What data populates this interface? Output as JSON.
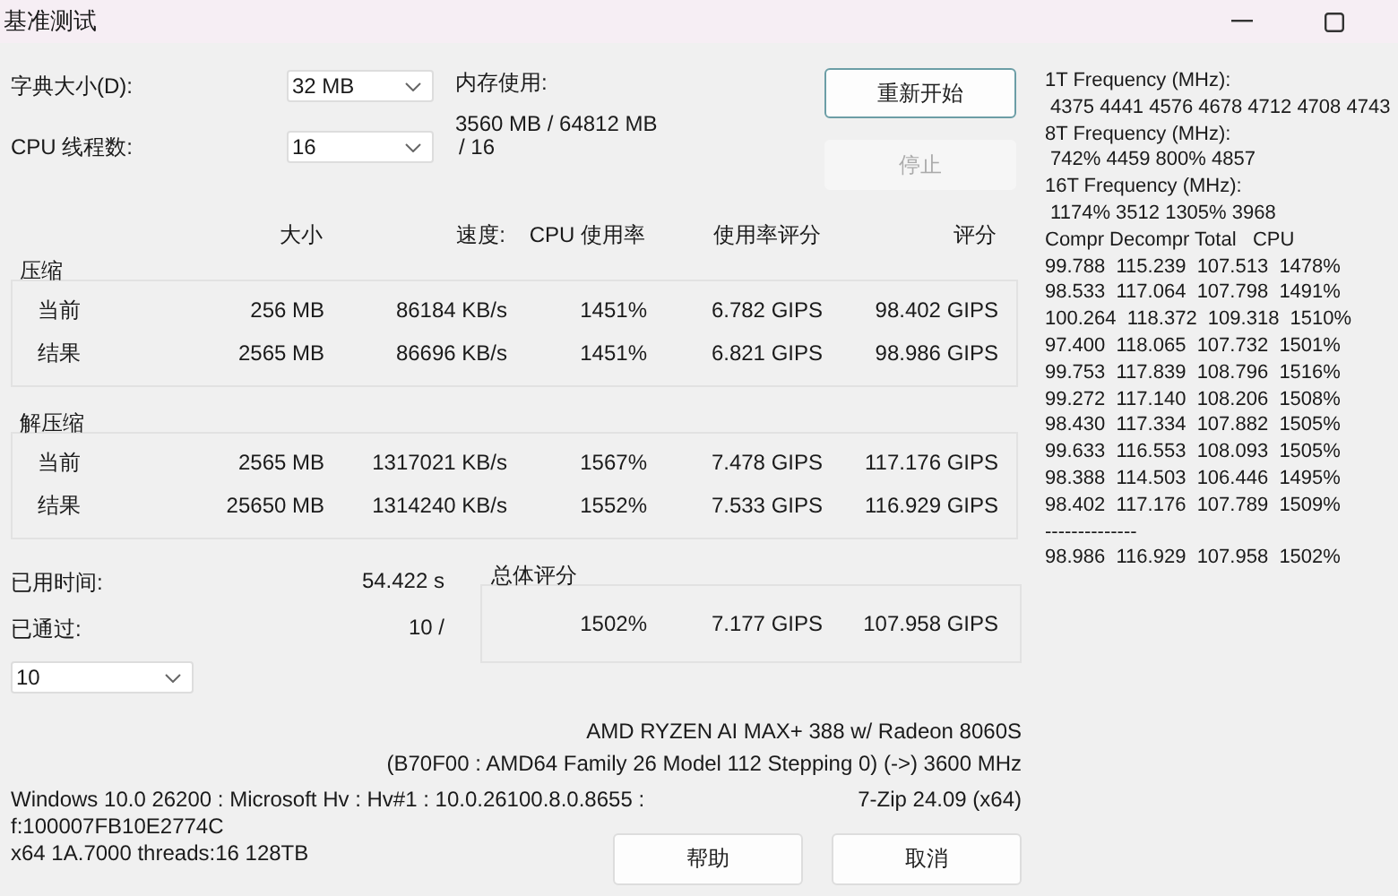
{
  "window": {
    "title": "基准测试"
  },
  "dictionary": {
    "label": "字典大小(D):",
    "value": "32 MB"
  },
  "threads": {
    "label": "CPU 线程数:",
    "value": "16",
    "total": "/ 16"
  },
  "memory": {
    "label": "内存使用:",
    "value": "3560 MB / 64812 MB"
  },
  "side_buttons": [
    {
      "label": "重新开始",
      "disabled": false
    },
    {
      "label": "停止",
      "disabled": true
    }
  ],
  "table": {
    "columns": [
      "大小",
      "速度:",
      "CPU 使用率",
      "使用率评分",
      "评分"
    ],
    "groups": [
      {
        "title": "压缩",
        "rows": [
          {
            "label": "当前",
            "cells": [
              "256 MB",
              "86184 KB/s",
              "1451%",
              "6.782 GIPS",
              "98.402 GIPS"
            ]
          },
          {
            "label": "结果",
            "cells": [
              "2565 MB",
              "86696 KB/s",
              "1451%",
              "6.821 GIPS",
              "98.986 GIPS"
            ]
          }
        ]
      },
      {
        "title": "解压缩",
        "rows": [
          {
            "label": "当前",
            "cells": [
              "2565 MB",
              "1317021 KB/s",
              "1567%",
              "7.478 GIPS",
              "117.176 GIPS"
            ]
          },
          {
            "label": "结果",
            "cells": [
              "25650 MB",
              "1314240 KB/s",
              "1552%",
              "7.533 GIPS",
              "116.929 GIPS"
            ]
          }
        ]
      }
    ]
  },
  "elapsed": {
    "label": "已用时间:",
    "value": "54.422 s"
  },
  "passes": {
    "label": "已通过:",
    "value": "10 /",
    "select": "10"
  },
  "overall": {
    "title": "总体评分",
    "cells": [
      "1502%",
      "7.177 GIPS",
      "107.958 GIPS"
    ]
  },
  "cpu_info": [
    "AMD RYZEN AI MAX+ 388 w/ Radeon 8060S",
    "(B70F00 : AMD64 Family 26 Model 112 Stepping 0) (->) 3600 MHz"
  ],
  "system_info": [
    "Windows 10.0 26200 : Microsoft Hv : Hv#1 : 10.0.26100.8.0.8655 :",
    "f:100007FB10E2774C",
    "x64 1A.7000 threads:16 128TB"
  ],
  "version": "7-Zip 24.09 (x64)",
  "bottom_buttons": [
    {
      "label": "帮助"
    },
    {
      "label": "取消"
    }
  ],
  "log": [
    "1T Frequency (MHz):",
    " 4375 4441 4576 4678 4712 4708 4743",
    "8T Frequency (MHz):",
    " 742% 4459 800% 4857",
    "16T Frequency (MHz):",
    " 1174% 3512 1305% 3968",
    "Compr Decompr Total   CPU",
    "99.788  115.239  107.513  1478%",
    "98.533  117.064  107.798  1491%",
    "100.264  118.372  109.318  1510%",
    "97.400  118.065  107.732  1501%",
    "99.753  117.839  108.796  1516%",
    "99.272  117.140  108.206  1508%",
    "98.430  117.334  107.882  1505%",
    "99.633  116.553  108.093  1505%",
    "98.388  114.503  106.446  1495%",
    "98.402  117.176  107.789  1509%",
    "--------------",
    "98.986  116.929  107.958  1502%"
  ]
}
